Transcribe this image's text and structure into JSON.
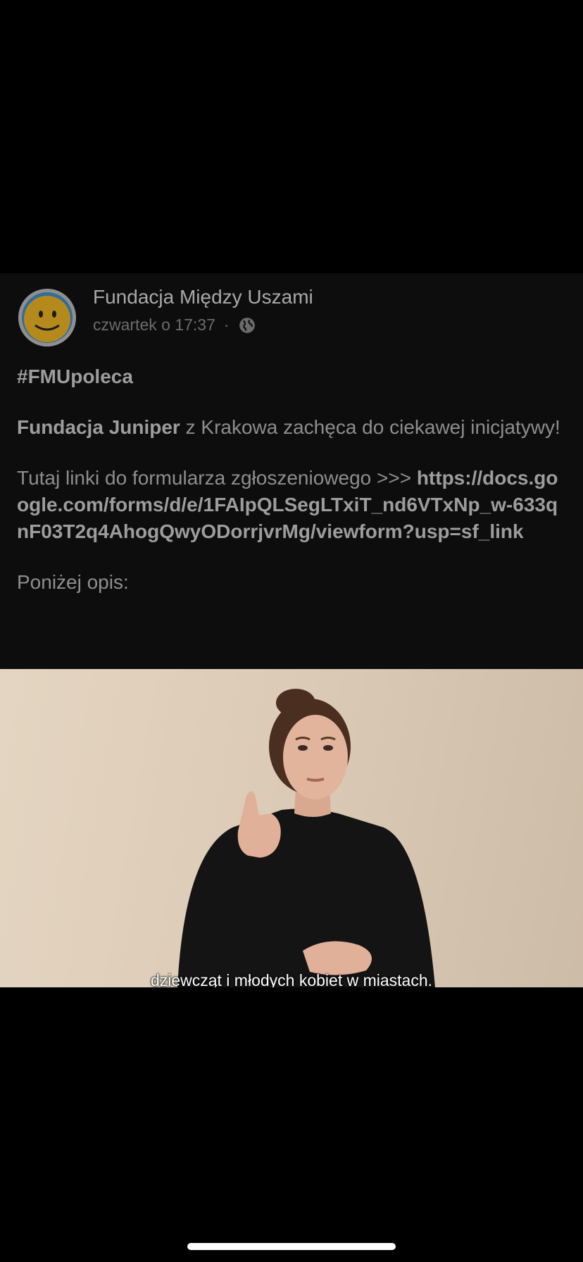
{
  "post": {
    "author": "Fundacja Między Uszami",
    "timestamp": "czwartek o 17:37",
    "separator": "·",
    "privacy_icon": "globe-icon",
    "avatar_icon": "smiley-avatar",
    "hashtag": "#FMUpoleca",
    "para1_bold": "Fundacja Juniper",
    "para1_rest": " z Krakowa zachęca do ciekawej inicjatywy!",
    "para2_text": "Tutaj linki do formularza zgłoszeniowego >>> ",
    "para2_link": "https://docs.google.com/forms/d/e/1FAIpQLSegLTxiT_nd6VTxNp_w-633qnF03T2q4AhogQwyODorrjvrMg/viewform?usp=sf_link",
    "para3": "Poniżej opis:"
  },
  "video": {
    "caption": "dziewcząt i młodych kobiet w miastach."
  },
  "colors": {
    "background": "#000000",
    "post_background": "#0d0d0d",
    "text": "#8e8e8e"
  }
}
